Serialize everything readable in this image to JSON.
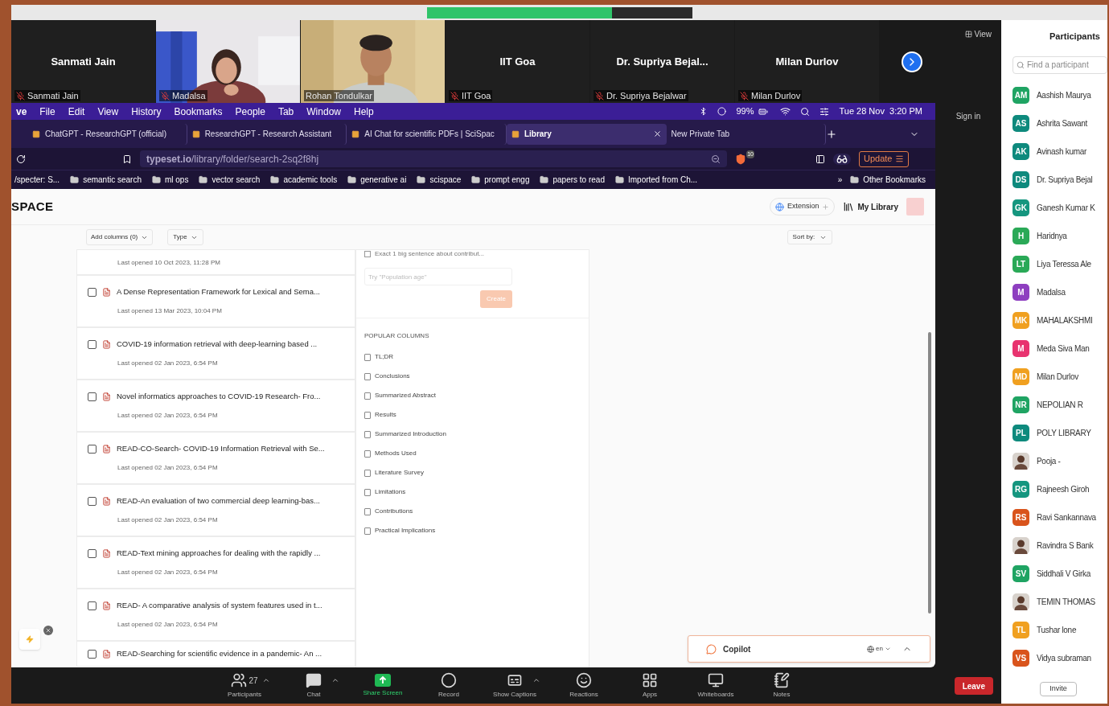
{
  "video_tiles": [
    {
      "kind": "name",
      "display_name": "Sanmati Jain",
      "label": "Sanmati Jain",
      "muted": true
    },
    {
      "kind": "video",
      "label": "Madalsa",
      "muted": true
    },
    {
      "kind": "video",
      "label": "Rohan Tondulkar",
      "muted": false
    },
    {
      "kind": "name",
      "display_name": "IIT Goa",
      "label": "IIT Goa",
      "muted": true
    },
    {
      "kind": "name",
      "display_name": "Dr. Supriya  Bejal...",
      "label": "Dr. Supriya Bejalwar",
      "muted": true
    },
    {
      "kind": "name",
      "display_name": "Milan Durlov",
      "label": "Milan Durlov",
      "muted": true
    }
  ],
  "view_button": "View",
  "sign_in": "Sign in",
  "menu_bar": {
    "items": [
      "ve",
      "File",
      "Edit",
      "View",
      "History",
      "Bookmarks",
      "People",
      "Tab",
      "Window",
      "Help"
    ],
    "battery": "99%",
    "clock": "Tue 28 Nov  3:20 PM"
  },
  "tabs": [
    {
      "title": "ChatGPT - ResearchGPT (official)",
      "selected": false
    },
    {
      "title": "ResearchGPT - Research Assistant",
      "selected": false
    },
    {
      "title": "AI Chat for scientific PDFs | SciSpac",
      "selected": false
    },
    {
      "title": "Library",
      "selected": true
    },
    {
      "title": "New Private Tab",
      "selected": false
    }
  ],
  "address": "**typeset.io**/library/folder/search-2sq2f8hj",
  "shields_count": "10",
  "update_button": "Update",
  "bookmarks": [
    {
      "kind": "page",
      "label": "/specter: S..."
    },
    {
      "kind": "folder",
      "label": "semantic search"
    },
    {
      "kind": "folder",
      "label": "ml ops"
    },
    {
      "kind": "folder",
      "label": "vector search"
    },
    {
      "kind": "folder",
      "label": "academic tools"
    },
    {
      "kind": "folder",
      "label": "generative ai"
    },
    {
      "kind": "folder",
      "label": "scispace"
    },
    {
      "kind": "folder",
      "label": "prompt engg"
    },
    {
      "kind": "folder",
      "label": "papers to read"
    },
    {
      "kind": "folder",
      "label": "Imported from Ch..."
    }
  ],
  "bookmarks_more": "»",
  "other_bookmarks": "Other Bookmarks",
  "page": {
    "brand": "SPACE",
    "extension_button": "Extension",
    "library_button": "My Library",
    "add_columns": "Add columns (0)",
    "type_filter": "Type",
    "sort": "Sort by:"
  },
  "papers": [
    {
      "opened": "Last opened 10 Oct 2023, 11:28 PM"
    },
    {
      "title": "A Dense Representation Framework for Lexical and Sema...",
      "opened": "Last opened 13 Mar 2023, 10:04 PM",
      "checked": false
    },
    {
      "title": "COVID-19 information retrieval with deep-learning based ...",
      "opened": "Last opened 02 Jan 2023, 6:54 PM",
      "checked": false
    },
    {
      "title": "Novel informatics approaches to COVID-19 Research- Fro...",
      "opened": "Last opened 02 Jan 2023, 6:54 PM",
      "checked": false
    },
    {
      "title": "READ-CO-Search- COVID-19 Information Retrieval with Se...",
      "opened": "Last opened 02 Jan 2023, 6:54 PM",
      "checked": false
    },
    {
      "title": "READ-An evaluation of two commercial deep learning-bas...",
      "opened": "Last opened 02 Jan 2023, 6:54 PM",
      "checked": false
    },
    {
      "title": "READ-Text mining approaches for dealing with the rapidly ...",
      "opened": "Last opened 02 Jan 2023, 6:54 PM",
      "checked": false
    },
    {
      "title": "READ- A comparative analysis of system features used in t...",
      "opened": "Last opened 02 Jan 2023, 6:54 PM",
      "checked": false
    },
    {
      "title": "READ-Searching for scientific evidence in a pandemic- An ...",
      "checked": false
    }
  ],
  "column_panel": {
    "partial_option": "Exact 1 big sentence about contribut...",
    "partial_option_checked": false,
    "input_placeholder": "Try \"Population age\"",
    "create_button": "Create",
    "create_disabled": true,
    "heading": "POPULAR COLUMNS",
    "options": [
      "TL;DR",
      "Conclusions",
      "Summarized Abstract",
      "Results",
      "Summarized Introduction",
      "Methods Used",
      "Literature Survey",
      "Limitations",
      "Contributions",
      "Practical Implications"
    ]
  },
  "copilot": {
    "label": "Copilot",
    "language": "en"
  },
  "toolbar": [
    {
      "kind": "participants",
      "label": "Participants",
      "count": "27"
    },
    {
      "kind": "chat",
      "label": "Chat"
    },
    {
      "kind": "share",
      "label": "Share Screen"
    },
    {
      "kind": "record",
      "label": "Record"
    },
    {
      "kind": "captions",
      "label": "Show Captions"
    },
    {
      "kind": "reactions",
      "label": "Reactions"
    },
    {
      "kind": "apps",
      "label": "Apps"
    },
    {
      "kind": "whiteboards",
      "label": "Whiteboards"
    },
    {
      "kind": "notes",
      "label": "Notes"
    }
  ],
  "leave_button": "Leave",
  "participants_panel": {
    "title": "Participants",
    "search_placeholder": "Find a participant",
    "invite_button": "Invite",
    "people": [
      {
        "kind": "initials",
        "initials": "AM",
        "color": "#1fa463",
        "name": "Aashish Maurya"
      },
      {
        "kind": "initials",
        "initials": "AS",
        "color": "#0e8a7d",
        "name": "Ashrita Sawant"
      },
      {
        "kind": "initials",
        "initials": "AK",
        "color": "#0e8a7d",
        "name": "Avinash kumar"
      },
      {
        "kind": "initials",
        "initials": "DS",
        "color": "#0e8a7d",
        "name": "Dr. Supriya Bejal"
      },
      {
        "kind": "initials",
        "initials": "GK",
        "color": "#15967f",
        "name": "Ganesh Kumar K"
      },
      {
        "kind": "initials",
        "initials": "H",
        "color": "#2aa957",
        "name": "Haridnya"
      },
      {
        "kind": "initials",
        "initials": "LT",
        "color": "#2aa957",
        "name": "Liya Teressa Ale"
      },
      {
        "kind": "initials",
        "initials": "M",
        "color": "#8e3fc0",
        "name": "Madalsa"
      },
      {
        "kind": "initials",
        "initials": "MK",
        "color": "#f0a020",
        "name": "MAHALAKSHMI"
      },
      {
        "kind": "initials",
        "initials": "M",
        "color": "#e8336f",
        "name": "Meda Siva Man"
      },
      {
        "kind": "initials",
        "initials": "MD",
        "color": "#f0a020",
        "name": "Milan Durlov"
      },
      {
        "kind": "initials",
        "initials": "NR",
        "color": "#1fa463",
        "name": "NEPOLIAN R"
      },
      {
        "kind": "initials",
        "initials": "PL",
        "color": "#0e8a7d",
        "name": "POLY LIBRARY"
      },
      {
        "name": "Pooja -"
      },
      {
        "kind": "initials",
        "initials": "RG",
        "color": "#15967f",
        "name": "Rajneesh Giroh"
      },
      {
        "kind": "initials",
        "initials": "RS",
        "color": "#d9541c",
        "name": "Ravi Sankannava"
      },
      {
        "name": "Ravindra S Bank"
      },
      {
        "kind": "initials",
        "initials": "SV",
        "color": "#1fa463",
        "name": "Siddhali V Girka"
      },
      {
        "name": "TEMIN THOMAS"
      },
      {
        "kind": "initials",
        "initials": "TL",
        "color": "#f0a020",
        "name": "Tushar lone"
      },
      {
        "kind": "initials",
        "initials": "VS",
        "color": "#d9541c",
        "name": "Vidya subraman"
      }
    ]
  }
}
